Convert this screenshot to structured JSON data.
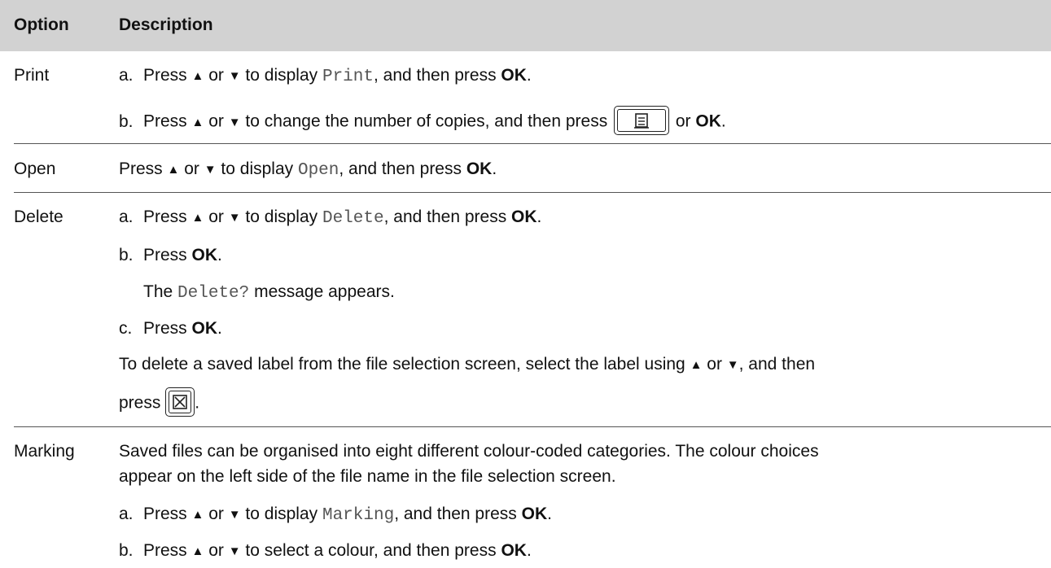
{
  "header": {
    "col1": "Option",
    "col2": "Description"
  },
  "glyphs": {
    "up": "▲",
    "down": "▼",
    "print_key": "print-key-icon",
    "cancel_key": "cancel-key-icon"
  },
  "rows": {
    "print": {
      "option": "Print",
      "a_label": "a.",
      "a_pre": "Press ",
      "a_or": " or ",
      "a_mid": " to display ",
      "a_code": "Print",
      "a_post": ", and then press ",
      "a_ok": "OK",
      "a_end": ".",
      "b_label": "b.",
      "b_pre": "Press ",
      "b_or": " or ",
      "b_mid": " to change the number of copies, and then press ",
      "b_or2": " or ",
      "b_ok": "OK",
      "b_end": "."
    },
    "open": {
      "option": "Open",
      "pre": "Press ",
      "or": " or ",
      "mid": " to display ",
      "code": "Open",
      "post": ", and then press ",
      "ok": "OK",
      "end": "."
    },
    "delete": {
      "option": "Delete",
      "a_label": "a.",
      "a_pre": "Press ",
      "a_or": " or ",
      "a_mid": " to display ",
      "a_code": "Delete",
      "a_post": ", and then press ",
      "a_ok": "OK",
      "a_end": ".",
      "b_label": "b.",
      "b_pre": "Press ",
      "b_ok": "OK",
      "b_end": ".",
      "msg_pre": "The ",
      "msg_code": "Delete?",
      "msg_post": " message appears.",
      "c_label": "c.",
      "c_pre": "Press ",
      "c_ok": "OK",
      "c_end": ".",
      "note_line1_pre": "To delete a saved label from the file selection screen, select the label using ",
      "note_or": " or ",
      "note_line1_post": ", and then",
      "note_line2_pre": "press ",
      "note_line2_end": "."
    },
    "marking": {
      "option": "Marking",
      "intro_line1": "Saved files can be organised into eight different colour-coded categories. The colour choices",
      "intro_line2": "appear on the left side of the file name in the file selection screen.",
      "a_label": "a.",
      "a_pre": "Press ",
      "a_or": " or ",
      "a_mid": " to display ",
      "a_code": "Marking",
      "a_post": ", and then press ",
      "a_ok": "OK",
      "a_end": ".",
      "b_label": "b.",
      "b_pre": "Press ",
      "b_or": " or ",
      "b_mid": " to select a colour, and then press ",
      "b_ok": "OK",
      "b_end": "."
    }
  }
}
